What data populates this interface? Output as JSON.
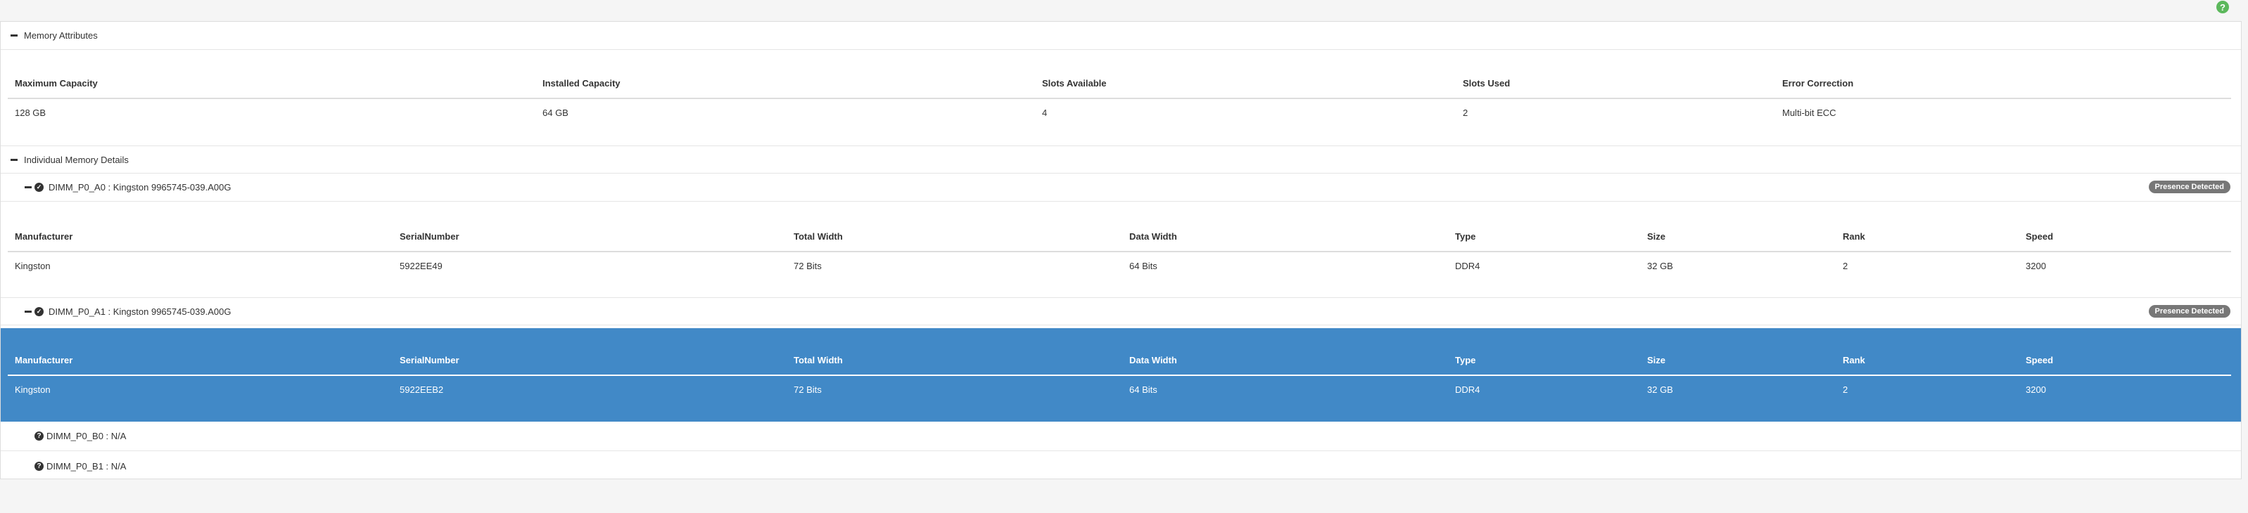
{
  "help_icon_glyph": "?",
  "memory_attributes": {
    "title": "Memory Attributes",
    "columns": [
      "Maximum Capacity",
      "Installed Capacity",
      "Slots Available",
      "Slots Used",
      "Error Correction"
    ],
    "values": [
      "128 GB",
      "64 GB",
      "4",
      "2",
      "Multi-bit ECC"
    ]
  },
  "individual_details": {
    "title": "Individual Memory Details",
    "dimm_columns": [
      "Manufacturer",
      "SerialNumber",
      "Total Width",
      "Data Width",
      "Type",
      "Size",
      "Rank",
      "Speed"
    ],
    "dimms": [
      {
        "label": "DIMM_P0_A0 : Kingston 9965745-039.A00G",
        "badge": "Presence Detected",
        "values": [
          "Kingston",
          "5922EE49",
          "72 Bits",
          "64 Bits",
          "DDR4",
          "32 GB",
          "2",
          "3200"
        ]
      },
      {
        "label": "DIMM_P0_A1 : Kingston 9965745-039.A00G",
        "badge": "Presence Detected",
        "values": [
          "Kingston",
          "5922EEB2",
          "72 Bits",
          "64 Bits",
          "DDR4",
          "32 GB",
          "2",
          "3200"
        ]
      }
    ],
    "empty_slots": [
      {
        "label": "DIMM_P0_B0 : N/A"
      },
      {
        "label": "DIMM_P0_B1 : N/A"
      }
    ]
  },
  "colors": {
    "highlight": "#4189c7",
    "help": "#5cb85c",
    "badge": "#777777"
  },
  "icons": {
    "help": "question-circle-icon",
    "collapse": "minus-icon",
    "check": "check-circle-icon",
    "unknown": "question-circle-icon"
  }
}
